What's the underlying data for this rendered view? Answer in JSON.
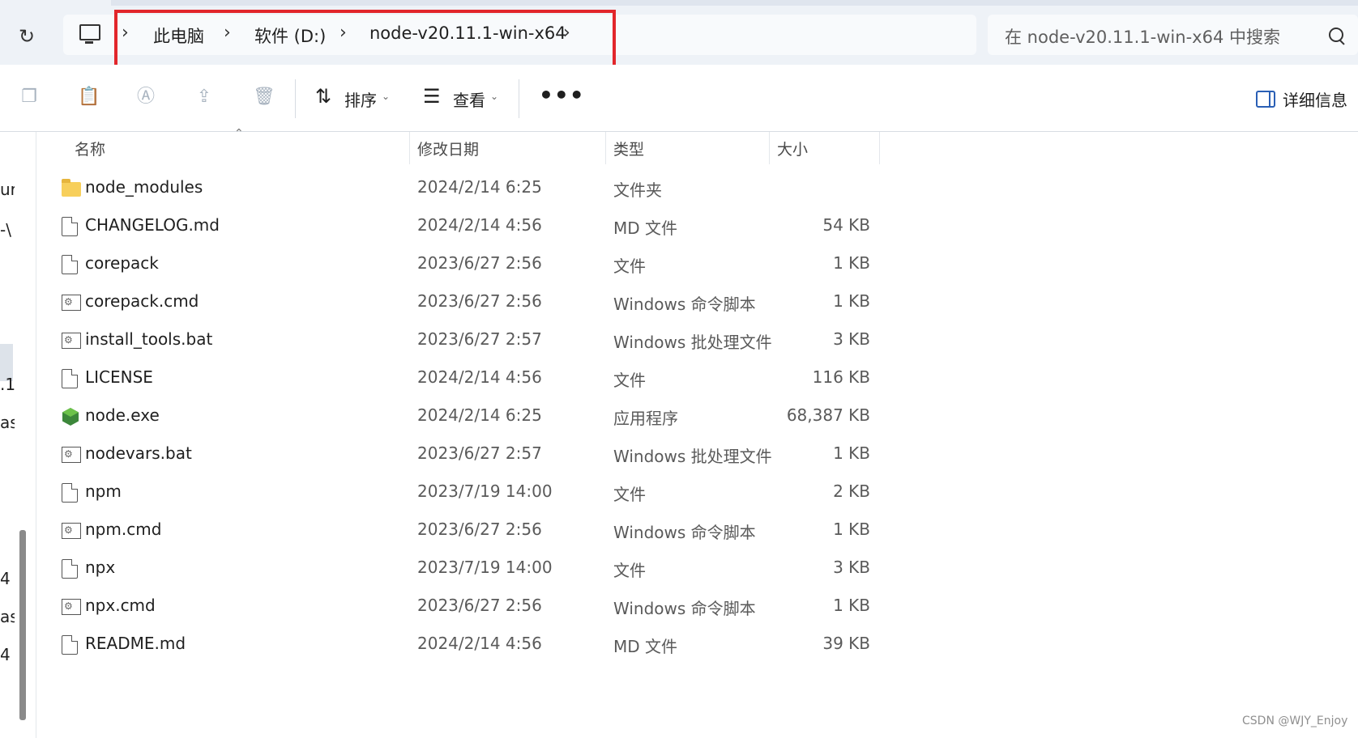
{
  "address_bar": {
    "breadcrumbs": [
      "此电脑",
      "软件 (D:)",
      "node-v20.11.1-win-x64"
    ],
    "search_placeholder": "在 node-v20.11.1-win-x64 中搜索"
  },
  "toolbar": {
    "sort_label": "排序",
    "view_label": "查看",
    "details_label": "详细信息",
    "more_label": "•••"
  },
  "left_nav_fragments": [
    "ur",
    "-\\",
    ".1",
    "as",
    "4",
    "as",
    "4"
  ],
  "columns": {
    "name": "名称",
    "modified": "修改日期",
    "type": "类型",
    "size": "大小"
  },
  "files": [
    {
      "name": "node_modules",
      "modified": "2024/2/14 6:25",
      "type": "文件夹",
      "size": "",
      "icon": "folder-icon"
    },
    {
      "name": "CHANGELOG.md",
      "modified": "2024/2/14 4:56",
      "type": "MD 文件",
      "size": "54 KB",
      "icon": "document-icon"
    },
    {
      "name": "corepack",
      "modified": "2023/6/27 2:56",
      "type": "文件",
      "size": "1 KB",
      "icon": "document-icon"
    },
    {
      "name": "corepack.cmd",
      "modified": "2023/6/27 2:56",
      "type": "Windows 命令脚本",
      "size": "1 KB",
      "icon": "script-icon"
    },
    {
      "name": "install_tools.bat",
      "modified": "2023/6/27 2:57",
      "type": "Windows 批处理文件",
      "size": "3 KB",
      "icon": "script-icon"
    },
    {
      "name": "LICENSE",
      "modified": "2024/2/14 4:56",
      "type": "文件",
      "size": "116 KB",
      "icon": "document-icon"
    },
    {
      "name": "node.exe",
      "modified": "2024/2/14 6:25",
      "type": "应用程序",
      "size": "68,387 KB",
      "icon": "node-exe-icon"
    },
    {
      "name": "nodevars.bat",
      "modified": "2023/6/27 2:57",
      "type": "Windows 批处理文件",
      "size": "1 KB",
      "icon": "script-icon"
    },
    {
      "name": "npm",
      "modified": "2023/7/19 14:00",
      "type": "文件",
      "size": "2 KB",
      "icon": "document-icon"
    },
    {
      "name": "npm.cmd",
      "modified": "2023/6/27 2:56",
      "type": "Windows 命令脚本",
      "size": "1 KB",
      "icon": "script-icon"
    },
    {
      "name": "npx",
      "modified": "2023/7/19 14:00",
      "type": "文件",
      "size": "3 KB",
      "icon": "document-icon"
    },
    {
      "name": "npx.cmd",
      "modified": "2023/6/27 2:56",
      "type": "Windows 命令脚本",
      "size": "1 KB",
      "icon": "script-icon"
    },
    {
      "name": "README.md",
      "modified": "2024/2/14 4:56",
      "type": "MD 文件",
      "size": "39 KB",
      "icon": "document-icon"
    }
  ],
  "watermark": "CSDN @WJY_Enjoy",
  "colors": {
    "highlight_border": "#e2262b",
    "folder": "#f7cf5b",
    "node_green": "#3c873a",
    "accent_blue": "#2a5fb5"
  }
}
